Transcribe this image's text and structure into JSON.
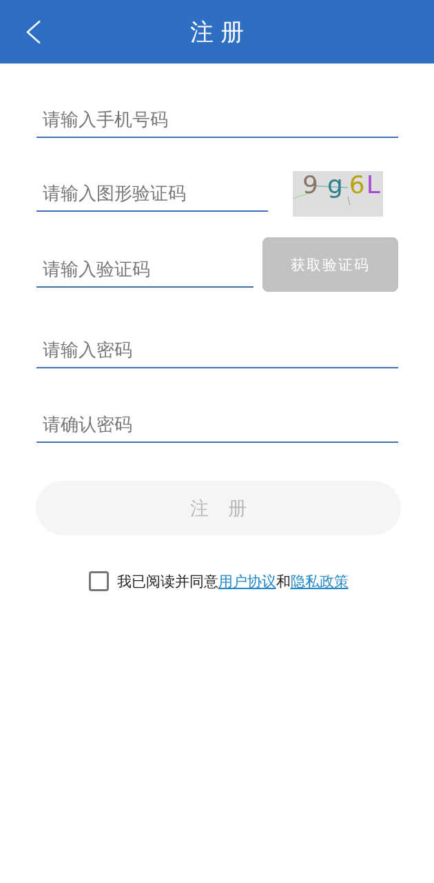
{
  "header": {
    "title": "注 册"
  },
  "form": {
    "fields": [
      {
        "kind": "text",
        "placeholder": "请输入手机号码"
      },
      {
        "kind": "captcha",
        "placeholder": "请输入图形验证码",
        "captcha": [
          {
            "text": "9",
            "color": "#8b7669"
          },
          {
            "text": "g",
            "color": "#2e7f87"
          },
          {
            "text": "6",
            "color": "#b8a412"
          },
          {
            "text": "L",
            "color": "#a84ad8"
          }
        ]
      },
      {
        "kind": "sms",
        "placeholder": "请输入验证码",
        "button": {
          "label": "获取验证码",
          "disabled": true
        }
      },
      {
        "kind": "password",
        "placeholder": "请输入密码"
      },
      {
        "kind": "password",
        "placeholder": "请确认密码"
      }
    ]
  },
  "register_button": {
    "label": "注 册",
    "disabled": true
  },
  "agreement": {
    "checked": false,
    "parts": [
      {
        "kind": "text",
        "text": "我已阅读并同意"
      },
      {
        "kind": "link",
        "text": "用户协议"
      },
      {
        "kind": "text",
        "text": "和"
      },
      {
        "kind": "link",
        "text": "隐私政策"
      }
    ]
  }
}
